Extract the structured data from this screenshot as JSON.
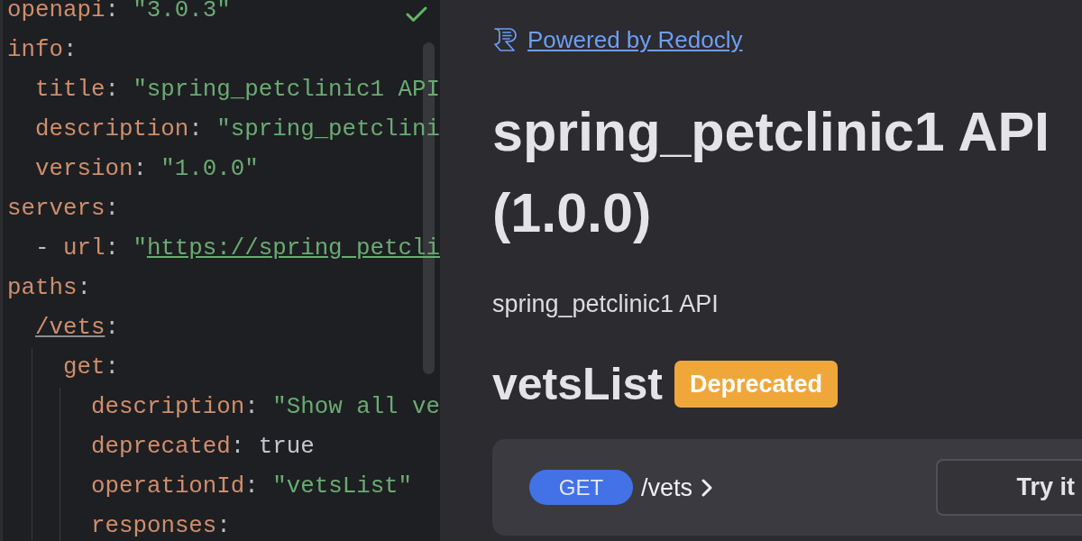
{
  "editor": {
    "lines": [
      {
        "tokens": [
          {
            "kind": "key",
            "text": "openapi"
          },
          {
            "kind": "punct",
            "text": ": "
          },
          {
            "kind": "string",
            "text": "\"3.0.3\""
          }
        ]
      },
      {
        "tokens": [
          {
            "kind": "key",
            "text": "info"
          },
          {
            "kind": "punct",
            "text": ":"
          }
        ],
        "children": [
          {
            "tokens": [
              {
                "kind": "key",
                "text": "title"
              },
              {
                "kind": "punct",
                "text": ": "
              },
              {
                "kind": "string",
                "text": "\"spring_petclinic1 API"
              }
            ]
          },
          {
            "tokens": [
              {
                "kind": "key",
                "text": "description"
              },
              {
                "kind": "punct",
                "text": ": "
              },
              {
                "kind": "string",
                "text": "\"spring_petclini"
              }
            ]
          },
          {
            "tokens": [
              {
                "kind": "key",
                "text": "version"
              },
              {
                "kind": "punct",
                "text": ": "
              },
              {
                "kind": "string",
                "text": "\"1.0.0\""
              }
            ]
          }
        ]
      },
      {
        "tokens": [
          {
            "kind": "key",
            "text": "servers"
          },
          {
            "kind": "punct",
            "text": ":"
          }
        ],
        "children": [
          {
            "tokens": [
              {
                "kind": "punct",
                "text": "- "
              },
              {
                "kind": "key",
                "text": "url"
              },
              {
                "kind": "punct",
                "text": ": "
              },
              {
                "kind": "string",
                "text": "\""
              },
              {
                "kind": "link",
                "text": "https://spring_petcli"
              }
            ]
          }
        ]
      },
      {
        "tokens": [
          {
            "kind": "key",
            "text": "paths"
          },
          {
            "kind": "punct",
            "text": ":"
          }
        ],
        "children": [
          {
            "tokens": [
              {
                "kind": "key_link",
                "text": "/vets"
              },
              {
                "kind": "punct",
                "text": ":"
              }
            ],
            "children": [
              {
                "tokens": [
                  {
                    "kind": "key",
                    "text": "get"
                  },
                  {
                    "kind": "punct",
                    "text": ":"
                  }
                ],
                "children": [
                  {
                    "tokens": [
                      {
                        "kind": "key",
                        "text": "description"
                      },
                      {
                        "kind": "punct",
                        "text": ": "
                      },
                      {
                        "kind": "string",
                        "text": "\"Show all ve"
                      }
                    ]
                  },
                  {
                    "tokens": [
                      {
                        "kind": "key",
                        "text": "deprecated"
                      },
                      {
                        "kind": "punct",
                        "text": ": "
                      },
                      {
                        "kind": "keyword",
                        "text": "true"
                      }
                    ]
                  },
                  {
                    "tokens": [
                      {
                        "kind": "key",
                        "text": "operationId"
                      },
                      {
                        "kind": "punct",
                        "text": ": "
                      },
                      {
                        "kind": "string",
                        "text": "\"vetsList\""
                      }
                    ]
                  },
                  {
                    "tokens": [
                      {
                        "kind": "key",
                        "text": "responses"
                      },
                      {
                        "kind": "punct",
                        "text": ":"
                      }
                    ]
                  }
                ]
              }
            ]
          }
        ]
      }
    ]
  },
  "docs": {
    "powered_by": "Powered by Redocly",
    "title": "spring_petclinic1 API (1.0.0)",
    "description": "spring_petclinic1 API",
    "operation": {
      "name": "vetsList",
      "deprecated": true,
      "badge": "Deprecated",
      "method": "GET",
      "path": "/vets",
      "try_button": "Try it"
    }
  }
}
